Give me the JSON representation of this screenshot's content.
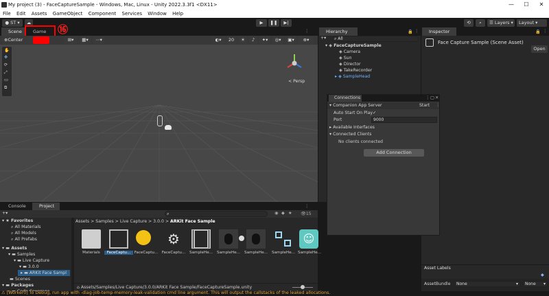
{
  "window": {
    "title": "My project (3) - FaceCaptureSample - Windows, Mac, Linux - Unity 2022.3.3f1 <DX11>",
    "minimize": "—",
    "maximize": "☐",
    "close": "✕"
  },
  "menu": [
    "File",
    "Edit",
    "Assets",
    "GameObject",
    "Component",
    "Services",
    "Window",
    "Help"
  ],
  "toolbar": {
    "account": "ST",
    "play": "▶",
    "pause": "❚❚",
    "step": "▶|",
    "layers": "Layers",
    "layout": "Layout"
  },
  "scene_tab": {
    "label": "Scene",
    "center": "Center",
    "persp": "< Persp",
    "zoom": "20"
  },
  "game_tab": {
    "label": "Game",
    "annotation": "⑯",
    "highlight_color": "#ff0000"
  },
  "hierarchy": {
    "tab": "Hierarchy",
    "search": "All",
    "items": [
      {
        "label": "FaceCaptureSample",
        "level": 0,
        "bold": true
      },
      {
        "label": "Camera",
        "level": 1
      },
      {
        "label": "Sun",
        "level": 1
      },
      {
        "label": "Director",
        "level": 1
      },
      {
        "label": "TakeRecorder",
        "level": 1
      },
      {
        "label": "SampleHead",
        "level": 1,
        "blue": true
      }
    ]
  },
  "inspector": {
    "tab": "Inspector",
    "title": "Face Capture Sample (Scene Asset)",
    "open": "Open",
    "asset_labels": "Asset Labels",
    "asset_bundle_label": "AssetBundle",
    "asset_bundle_value": "None",
    "asset_bundle_variant": "None"
  },
  "connections": {
    "title": "Connections",
    "server": "Companion App Server",
    "start": "Start",
    "auto_start": "Auto Start On Play",
    "check": "✓",
    "port_label": "Port",
    "port_value": "9000",
    "available": "Available Interfaces",
    "connected": "Connected Clients",
    "no_clients": "No clients connected",
    "add": "Add Connection"
  },
  "project": {
    "console_tab": "Console",
    "project_tab": "Project",
    "count": "15",
    "favorites": "Favorites",
    "fav_items": [
      "All Materials",
      "All Models",
      "All Prefabs"
    ],
    "assets": "Assets",
    "tree": [
      {
        "label": "Samples",
        "level": 1
      },
      {
        "label": "Live Capture",
        "level": 2
      },
      {
        "label": "3.0.0",
        "level": 3
      },
      {
        "label": "ARKit Face Sampl",
        "level": 4,
        "selected": true
      },
      {
        "label": "Scenes",
        "level": 1
      }
    ],
    "packages": "Packages",
    "packages_child": "Code Coverage",
    "breadcrumb": [
      "Assets",
      "Samples",
      "Live Capture",
      "3.0.0",
      "ARKit Face Sample"
    ],
    "assets_grid": [
      "Materials",
      "FaceCaptu...",
      "FaceCaptu...",
      "FaceCaptu...",
      "SampleHe...",
      "SampleHe...",
      "SampleHe...",
      "SampleHe..."
    ],
    "path": "Assets/Samples/Live Capture/3.0.0/ARKit Face Sample/FaceCaptureSample.unity"
  },
  "status": {
    "text": "[Worker0] To Debug, run app with -diag-job-temp-memory-leak-validation cmd line argument. This will output the callstacks of the leaked allocations."
  }
}
